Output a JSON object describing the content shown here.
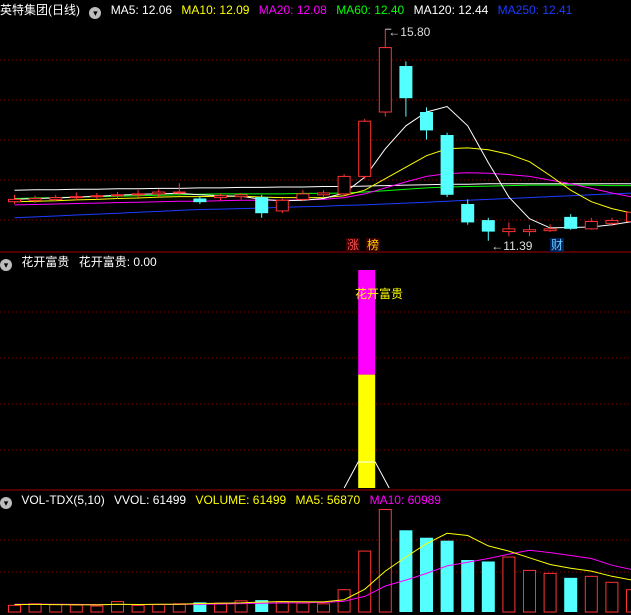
{
  "main_panel": {
    "title": "英特集团(日线)",
    "ma": [
      {
        "label": "MA5: 12.06",
        "color": "#ffffff"
      },
      {
        "label": "MA10: 12.09",
        "color": "#ffff00"
      },
      {
        "label": "MA20: 12.08",
        "color": "#ff00ff"
      },
      {
        "label": "MA60: 12.40",
        "color": "#00ff00"
      },
      {
        "label": "MA120: 12.44",
        "color": "#ffffff"
      },
      {
        "label": "MA250: 12.41",
        "color": "#0000ff"
      }
    ],
    "high_label": "15.80",
    "low_label": "11.39",
    "tag_zhang": "涨",
    "tag_bang": "榜",
    "tag_cai": "财"
  },
  "indicator_panel": {
    "title": "花开富贵",
    "value_label": "花开富贵: 0.00",
    "bar_label": "花开富贵"
  },
  "volume_panel": {
    "title": "VOL-TDX(5,10)",
    "items": [
      {
        "label": "VVOL: 61499",
        "color": "#ffffff"
      },
      {
        "label": "VOLUME: 61499",
        "color": "#ffff00"
      },
      {
        "label": "MA5: 56870",
        "color": "#ffff00"
      },
      {
        "label": "MA10: 60989",
        "color": "#ff00ff"
      }
    ]
  },
  "colors": {
    "up": "#ff3232",
    "down": "#54ffff",
    "grid": "#8b0000",
    "magenta": "#ff00ff",
    "yellow": "#ffff00"
  },
  "candles": [
    {
      "o": 12.05,
      "c": 12.1,
      "h": 12.2,
      "l": 12.0
    },
    {
      "o": 12.08,
      "c": 12.12,
      "h": 12.18,
      "l": 12.02
    },
    {
      "o": 12.1,
      "c": 12.14,
      "h": 12.2,
      "l": 12.05
    },
    {
      "o": 12.14,
      "c": 12.16,
      "h": 12.25,
      "l": 12.08
    },
    {
      "o": 12.16,
      "c": 12.18,
      "h": 12.24,
      "l": 12.1
    },
    {
      "o": 12.18,
      "c": 12.2,
      "h": 12.26,
      "l": 12.12
    },
    {
      "o": 12.2,
      "c": 12.22,
      "h": 12.3,
      "l": 12.14
    },
    {
      "o": 12.22,
      "c": 12.26,
      "h": 12.32,
      "l": 12.16
    },
    {
      "o": 12.24,
      "c": 12.26,
      "h": 12.45,
      "l": 12.18
    },
    {
      "o": 12.12,
      "c": 12.04,
      "h": 12.16,
      "l": 12.0
    },
    {
      "o": 12.14,
      "c": 12.18,
      "h": 12.22,
      "l": 12.08
    },
    {
      "o": 12.16,
      "c": 12.2,
      "h": 12.24,
      "l": 12.1
    },
    {
      "o": 12.15,
      "c": 11.8,
      "h": 12.2,
      "l": 11.7
    },
    {
      "o": 11.85,
      "c": 12.08,
      "h": 12.12,
      "l": 11.8
    },
    {
      "o": 12.1,
      "c": 12.22,
      "h": 12.3,
      "l": 12.06
    },
    {
      "o": 12.2,
      "c": 12.24,
      "h": 12.3,
      "l": 12.14
    },
    {
      "o": 12.22,
      "c": 12.6,
      "h": 12.65,
      "l": 12.18
    },
    {
      "o": 12.6,
      "c": 13.8,
      "h": 13.85,
      "l": 12.55
    },
    {
      "o": 14.0,
      "c": 15.4,
      "h": 15.8,
      "l": 13.9
    },
    {
      "o": 15.0,
      "c": 14.3,
      "h": 15.1,
      "l": 13.9
    },
    {
      "o": 14.0,
      "c": 13.6,
      "h": 14.1,
      "l": 13.4
    },
    {
      "o": 13.5,
      "c": 12.2,
      "h": 13.55,
      "l": 12.15
    },
    {
      "o": 12.0,
      "c": 11.6,
      "h": 12.1,
      "l": 11.55
    },
    {
      "o": 11.65,
      "c": 11.4,
      "h": 11.7,
      "l": 11.2
    },
    {
      "o": 11.4,
      "c": 11.46,
      "h": 11.6,
      "l": 11.3
    },
    {
      "o": 11.4,
      "c": 11.44,
      "h": 11.55,
      "l": 11.3
    },
    {
      "o": 11.42,
      "c": 11.46,
      "h": 11.56,
      "l": 11.39
    },
    {
      "o": 11.72,
      "c": 11.46,
      "h": 11.78,
      "l": 11.44
    },
    {
      "o": 11.46,
      "c": 11.62,
      "h": 11.7,
      "l": 11.44
    },
    {
      "o": 11.58,
      "c": 11.64,
      "h": 11.7,
      "l": 11.52
    },
    {
      "o": 11.62,
      "c": 11.82,
      "h": 11.9,
      "l": 11.58
    }
  ],
  "ma_lines": {
    "ma5": [
      12.1,
      12.12,
      12.13,
      12.15,
      12.17,
      12.19,
      12.21,
      12.22,
      12.23,
      12.2,
      12.18,
      12.17,
      12.1,
      12.07,
      12.08,
      12.12,
      12.24,
      12.58,
      13.2,
      13.7,
      14.0,
      14.12,
      13.7,
      12.9,
      12.15,
      11.68,
      11.48,
      11.49,
      11.5,
      11.55,
      11.62
    ],
    "ma10": [
      12.05,
      12.06,
      12.07,
      12.09,
      12.1,
      12.12,
      12.13,
      12.15,
      12.16,
      12.16,
      12.17,
      12.17,
      12.15,
      12.14,
      12.14,
      12.14,
      12.18,
      12.3,
      12.55,
      12.8,
      13.05,
      13.2,
      13.22,
      13.18,
      13.08,
      12.92,
      12.62,
      12.3,
      12.05,
      11.9,
      11.8
    ],
    "ma20": [
      11.98,
      11.99,
      12.0,
      12.01,
      12.02,
      12.03,
      12.04,
      12.05,
      12.06,
      12.06,
      12.07,
      12.08,
      12.08,
      12.08,
      12.09,
      12.1,
      12.14,
      12.22,
      12.35,
      12.48,
      12.6,
      12.66,
      12.68,
      12.67,
      12.64,
      12.6,
      12.52,
      12.44,
      12.34,
      12.24,
      12.15
    ],
    "ma60": [
      12.12,
      12.13,
      12.14,
      12.15,
      12.16,
      12.17,
      12.18,
      12.19,
      12.2,
      12.21,
      12.22,
      12.22,
      12.22,
      12.22,
      12.23,
      12.23,
      12.24,
      12.26,
      12.29,
      12.32,
      12.35,
      12.37,
      12.38,
      12.39,
      12.4,
      12.41,
      12.41,
      12.41,
      12.41,
      12.4,
      12.4
    ],
    "ma120": [
      12.3,
      12.31,
      12.31,
      12.32,
      12.32,
      12.33,
      12.33,
      12.34,
      12.34,
      12.35,
      12.35,
      12.36,
      12.36,
      12.37,
      12.37,
      12.38,
      12.38,
      12.39,
      12.4,
      12.41,
      12.42,
      12.43,
      12.43,
      12.44,
      12.44,
      12.44,
      12.44,
      12.44,
      12.44,
      12.44,
      12.44
    ],
    "ma250": [
      11.7,
      11.72,
      11.74,
      11.76,
      11.78,
      11.8,
      11.82,
      11.84,
      11.86,
      11.88,
      11.89,
      11.9,
      11.91,
      11.93,
      11.94,
      11.95,
      11.97,
      11.98,
      12.0,
      12.02,
      12.04,
      12.06,
      12.08,
      12.1,
      12.12,
      12.14,
      12.16,
      12.18,
      12.2,
      12.22,
      12.24
    ]
  },
  "indicator": {
    "bar_index": 17,
    "magenta_fraction": 0.48,
    "total_fraction": 1.0
  },
  "volume": {
    "ylim": [
      0,
      140000
    ],
    "values": [
      9000,
      11000,
      10000,
      9500,
      8000,
      14000,
      9000,
      10000,
      11000,
      13000,
      12000,
      15000,
      16000,
      14000,
      12000,
      11000,
      30000,
      82000,
      138000,
      110000,
      100000,
      96000,
      70000,
      68000,
      74000,
      56000,
      52000,
      46000,
      48000,
      40000,
      30000
    ],
    "ma5": [
      10000,
      10200,
      10000,
      9800,
      9500,
      10500,
      10100,
      10400,
      10500,
      11400,
      11800,
      12200,
      13400,
      14000,
      13800,
      13600,
      16600,
      30600,
      55000,
      74000,
      92000,
      106000,
      103000,
      89000,
      82000,
      73000,
      64000,
      59000,
      55000,
      48000,
      43000
    ],
    "ma10": [
      10500,
      10400,
      10300,
      10200,
      10000,
      10100,
      10000,
      10100,
      10200,
      10500,
      10800,
      11300,
      11800,
      12100,
      12400,
      12800,
      14500,
      21000,
      35000,
      43000,
      52000,
      62000,
      67000,
      72000,
      78000,
      83000,
      80000,
      76000,
      72000,
      63000,
      57000
    ]
  }
}
